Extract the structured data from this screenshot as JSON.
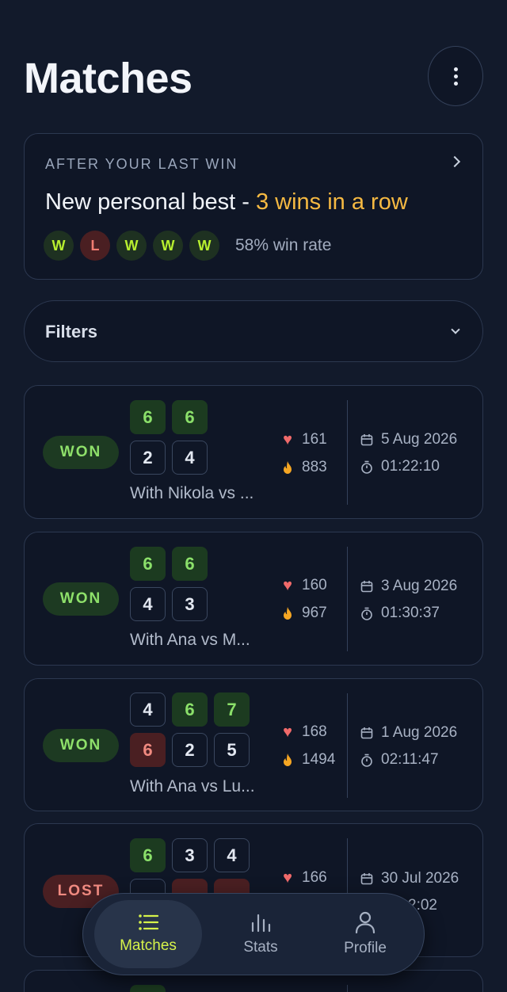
{
  "header": {
    "title": "Matches",
    "menu_icon": "more-vertical-icon"
  },
  "streak_card": {
    "kicker": "AFTER YOUR LAST WIN",
    "headline_prefix": "New personal best - ",
    "headline_highlight": "3 wins in a row",
    "results": [
      "W",
      "L",
      "W",
      "W",
      "W"
    ],
    "win_rate": "58% win rate",
    "colors": {
      "highlight": "#f5b942",
      "win": "#b7ef2f",
      "loss": "#f17d72"
    }
  },
  "filters": {
    "label": "Filters"
  },
  "matches": [
    {
      "result": "WON",
      "sets_top": [
        "6",
        "6"
      ],
      "sets_bottom": [
        "2",
        "4"
      ],
      "partners": "With Nikola vs ...",
      "heart_rate": "161",
      "calories": "883",
      "date": "5 Aug 2026",
      "duration": "01:22:10"
    },
    {
      "result": "WON",
      "sets_top": [
        "6",
        "6"
      ],
      "sets_bottom": [
        "4",
        "3"
      ],
      "partners": "With Ana vs M...",
      "heart_rate": "160",
      "calories": "967",
      "date": "3 Aug 2026",
      "duration": "01:30:37"
    },
    {
      "result": "WON",
      "sets_top": [
        "4",
        "6",
        "7"
      ],
      "sets_bottom": [
        "6",
        "2",
        "5"
      ],
      "partners": "With Ana vs Lu...",
      "heart_rate": "168",
      "calories": "1494",
      "date": "1 Aug 2026",
      "duration": "02:11:47"
    },
    {
      "result": "LOST",
      "sets_top": [
        "6",
        "3",
        "4"
      ],
      "heart_rate": "166",
      "date": "30 Jul 2026",
      "duration_visible": "2:02"
    }
  ],
  "tabbar": {
    "tabs": [
      {
        "label": "Matches",
        "icon": "list-icon",
        "active": true
      },
      {
        "label": "Stats",
        "icon": "bar-chart-icon",
        "active": false
      },
      {
        "label": "Profile",
        "icon": "user-icon",
        "active": false
      }
    ],
    "active_color": "#d6f24a"
  }
}
